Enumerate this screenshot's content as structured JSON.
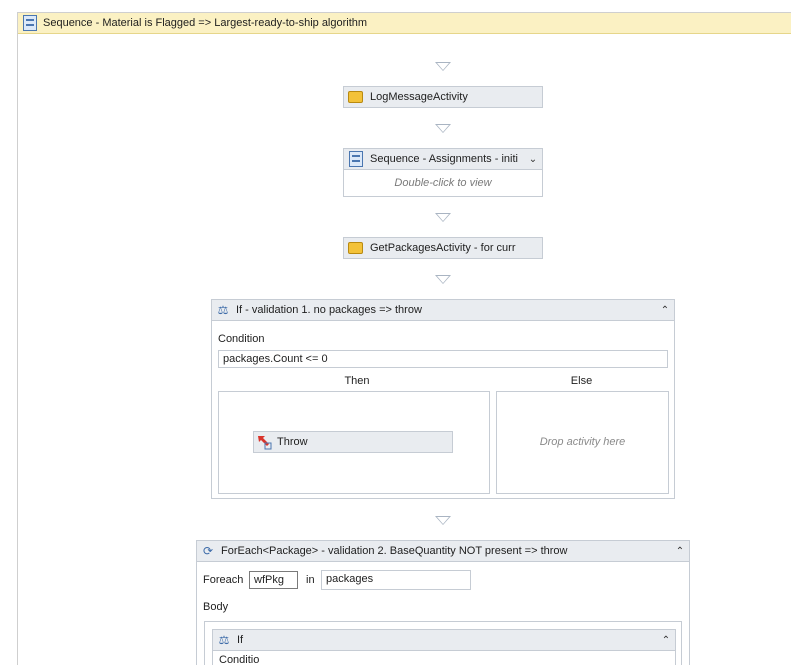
{
  "root": {
    "title": "Sequence - Material is Flagged => Largest-ready-to-ship algorithm",
    "icon": "sequence-icon"
  },
  "log_activity": {
    "label": "LogMessageActivity",
    "icon": "activity-icon"
  },
  "assign_sequence": {
    "label": "Sequence - Assignments - initi",
    "hint": "Double-click to view",
    "expand": "⌄"
  },
  "get_packages": {
    "label": "GetPackagesActivity - for curr"
  },
  "if_validation": {
    "title": "If - validation 1. no packages => throw",
    "collapse": "⌃",
    "condition_label": "Condition",
    "condition_value": "packages.Count <= 0",
    "then_label": "Then",
    "else_label": "Else",
    "throw_label": "Throw",
    "else_hint": "Drop activity here"
  },
  "foreach": {
    "title": "ForEach<Package> - validation 2. BaseQuantity NOT present => throw",
    "collapse": "⌃",
    "foreach_label": "Foreach",
    "var_value": "wfPkg",
    "in_label": "in",
    "collection_value": "packages",
    "body_label": "Body",
    "inner_if": {
      "title": "If",
      "collapse": "⌃",
      "condition_label": "Conditio"
    }
  },
  "colors": {
    "root_header": "#fbf1c3",
    "activity_bg": "#e9ecf0",
    "border": "#c6ccd4",
    "arrow": "#a9b4c2"
  }
}
